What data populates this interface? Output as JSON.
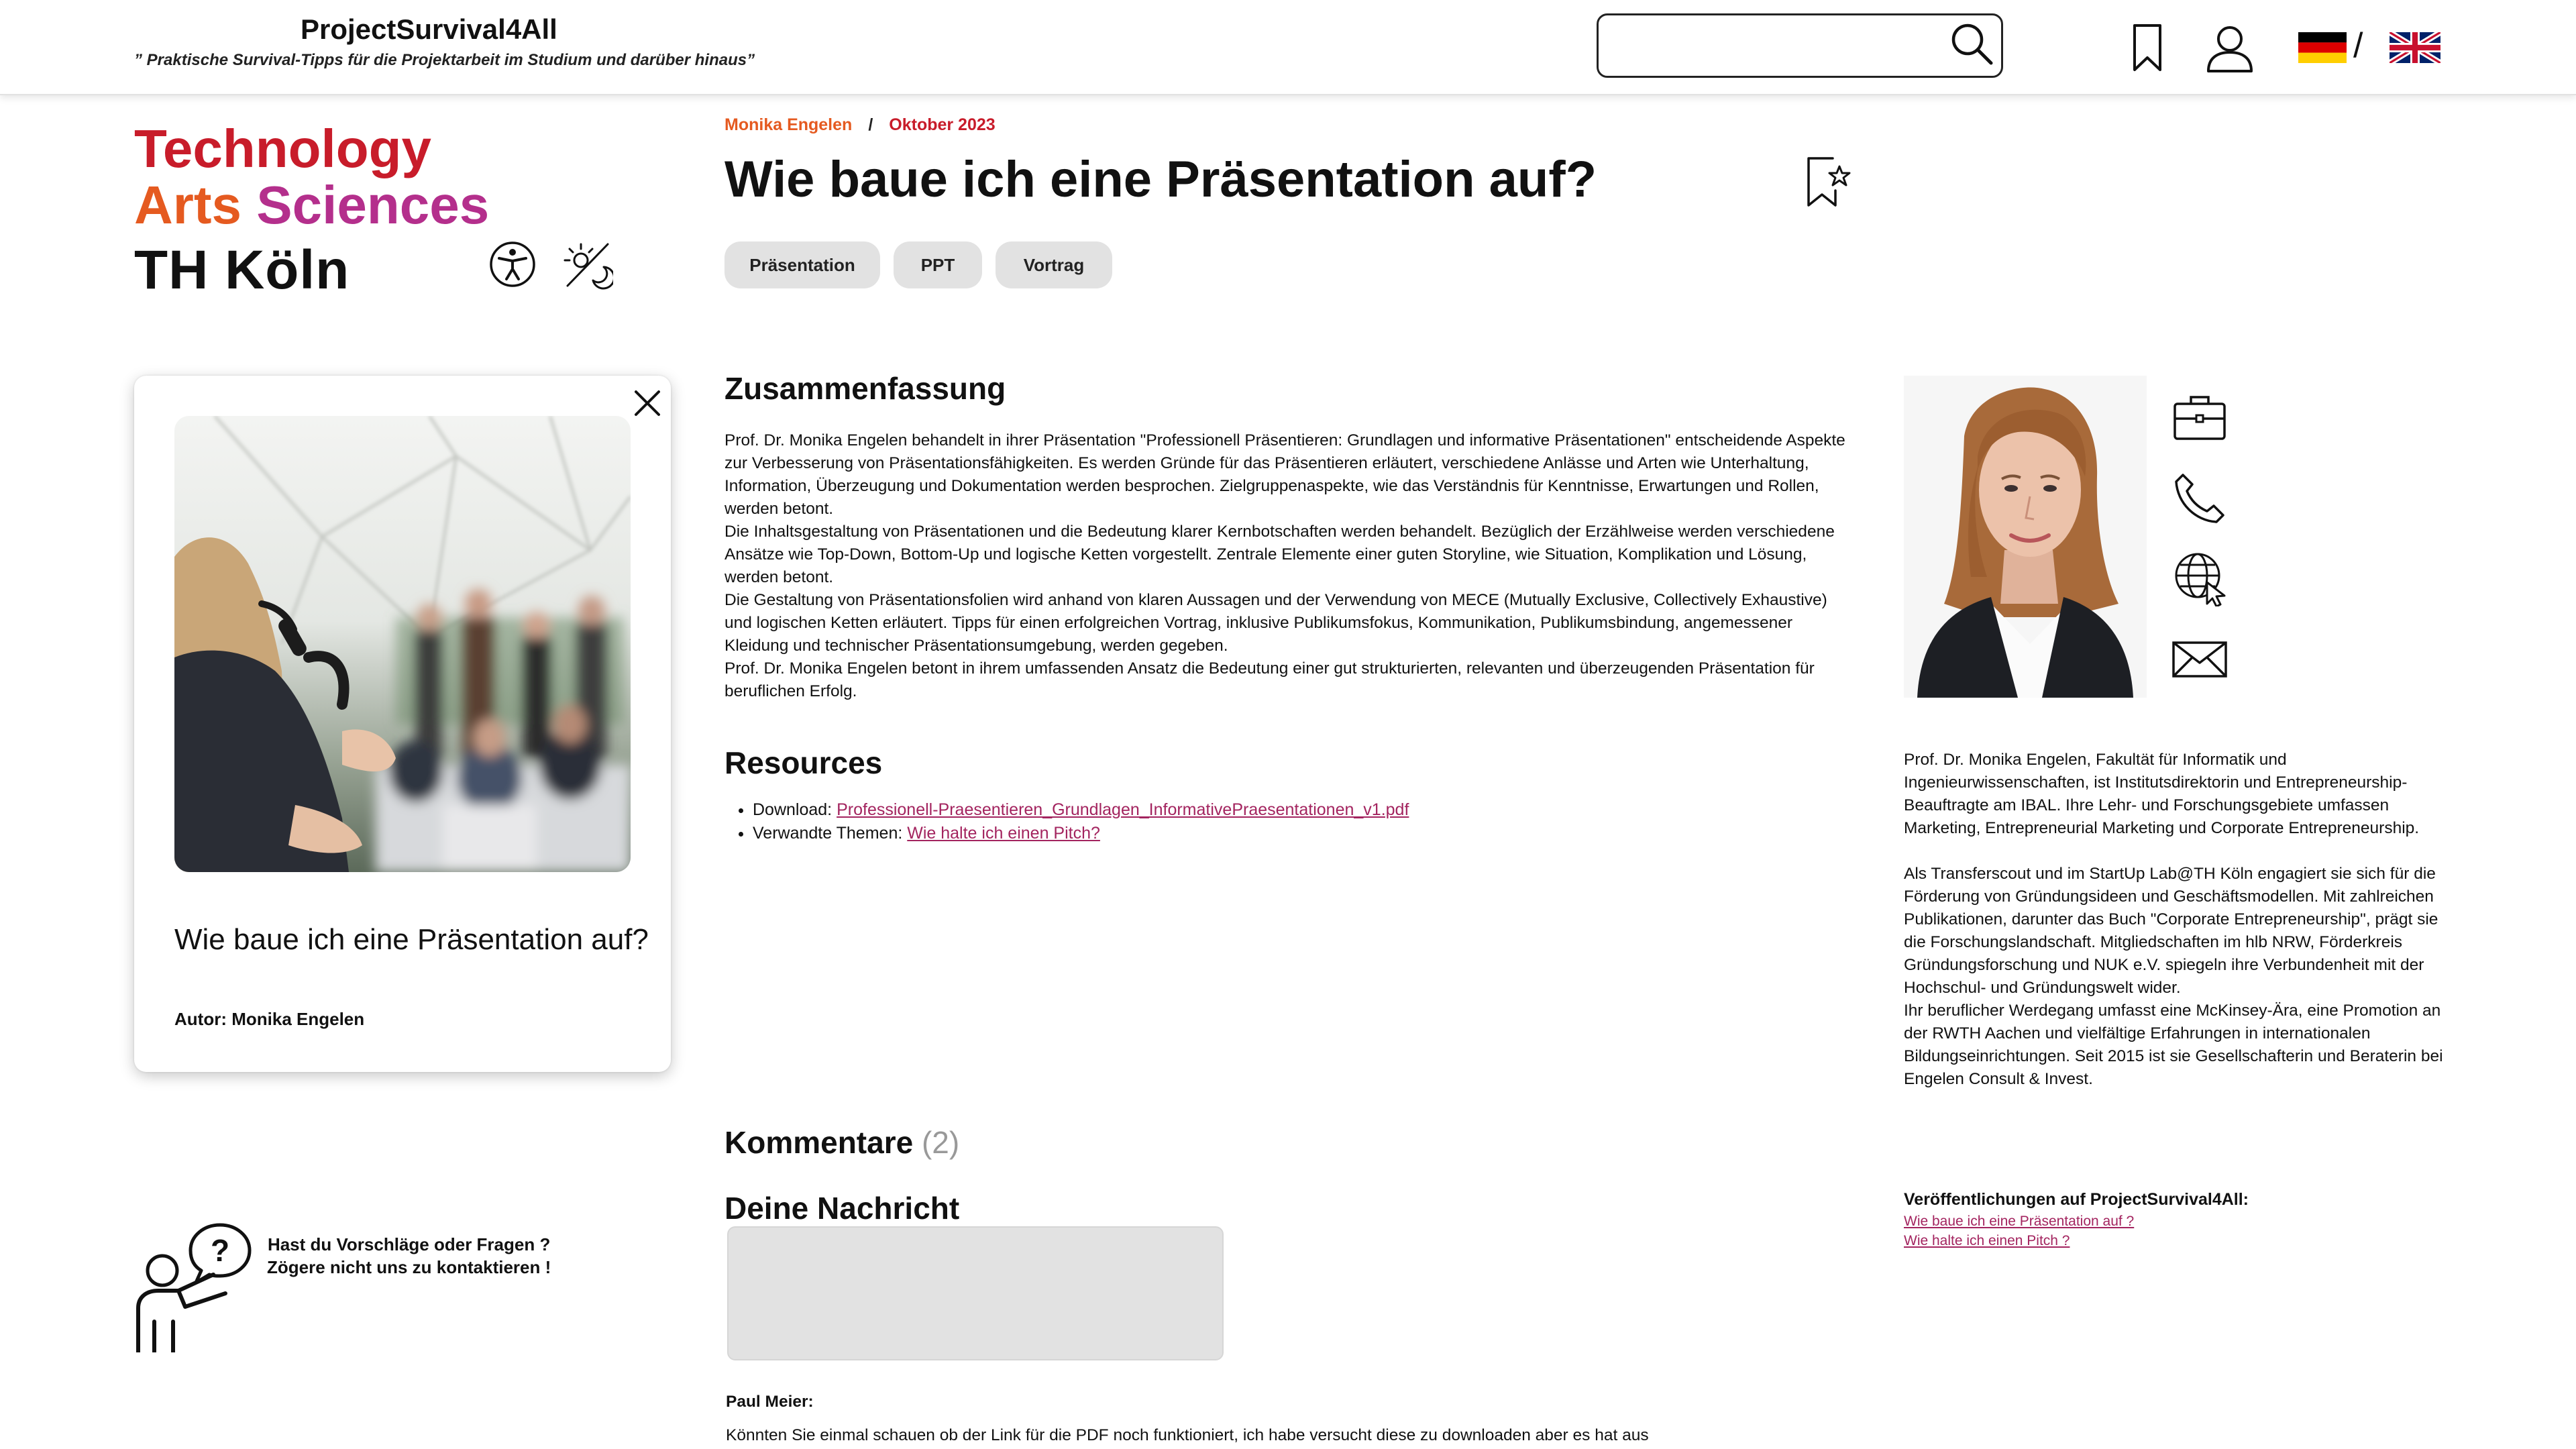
{
  "header": {
    "site_title": "ProjectSurvival4All",
    "tagline": "” Praktische Survival-Tipps für die Projektarbeit im Studium und darüber hinaus”",
    "search": {
      "value": "",
      "placeholder": ""
    },
    "language_separator": "/",
    "languages": [
      "de",
      "en"
    ]
  },
  "logo": {
    "line1": "Technology",
    "line2a": "Arts",
    "line2b": "Sciences",
    "line3": "TH Köln"
  },
  "colors": {
    "accent_red": "#c81c2a",
    "accent_orange": "#e55a20",
    "accent_magenta": "#b42f8c",
    "link": "#a3245f",
    "tag_bg": "#e2e2e2"
  },
  "icons": {
    "header": [
      "search-icon",
      "bookmark-icon",
      "user-icon",
      "flag-germany-icon",
      "flag-uk-icon"
    ],
    "left": [
      "accessibility-icon",
      "theme-toggle-icon",
      "close-icon",
      "contact-question-icon"
    ],
    "main": [
      "favorite-bookmark-star-icon"
    ],
    "contact": [
      "briefcase-icon",
      "phone-icon",
      "globe-icon",
      "mail-icon"
    ]
  },
  "card": {
    "title": "Wie baue ich eine Präsentation auf?",
    "author_label": "Autor:",
    "author_name": "Monika Engelen"
  },
  "contact": {
    "line1": "Hast du Vorschläge oder Fragen ?",
    "line2": "Zögere nicht uns zu kontaktieren !"
  },
  "article": {
    "author": "Monika Engelen",
    "separator": "/",
    "date": "Oktober 2023",
    "title": "Wie baue ich eine Präsentation auf?",
    "tags": [
      "Präsentation",
      "PPT",
      "Vortrag"
    ],
    "summary_heading": "Zusammenfassung",
    "summary": [
      "Prof. Dr. Monika Engelen behandelt in ihrer Präsentation \"Professionell Präsentieren: Grundlagen und informative Präsentationen\" entscheidende Aspekte zur Verbesserung von Präsentationsfähigkeiten. Es werden Gründe für das Präsentieren erläutert, verschiedene Anlässe und Arten wie Unterhaltung, Information, Überzeugung und Dokumentation werden besprochen. Zielgruppenaspekte, wie das Verständnis für Kenntnisse, Erwartungen und Rollen, werden betont.",
      "Die Inhaltsgestaltung von Präsentationen und die Bedeutung klarer Kernbotschaften werden behandelt. Bezüglich der Erzählweise werden verschiedene Ansätze wie Top-Down, Bottom-Up und logische Ketten vorgestellt. Zentrale Elemente einer guten Storyline, wie Situation, Komplikation und Lösung, werden betont.",
      "Die Gestaltung von Präsentationsfolien wird anhand von klaren Aussagen und der Verwendung von MECE (Mutually Exclusive, Collectively Exhaustive) und logischen Ketten erläutert. Tipps für einen erfolgreichen Vortrag, inklusive Publikumsfokus, Kommunikation, Publikumsbindung, angemessener Kleidung und technischer Präsentationsumgebung, werden gegeben.",
      "Prof. Dr. Monika Engelen betont in ihrem umfassenden Ansatz die Bedeutung einer gut strukturierten, relevanten und überzeugenden Präsentation für beruflichen Erfolg."
    ],
    "resources_heading": "Resources",
    "resources": [
      {
        "label": "Download:",
        "link_text": "Professionell-Praesentieren_Grundlagen_InformativePraesentationen_v1.pdf"
      },
      {
        "label": "Verwandte Themen:",
        "link_text": "Wie halte ich einen Pitch?"
      }
    ],
    "comments_heading": "Kommentare",
    "comments_count": "(2)",
    "message_heading": "Deine Nachricht",
    "message": {
      "value": "",
      "placeholder": ""
    },
    "comments": [
      {
        "author": "Paul Meier:",
        "text": "Könnten Sie einmal schauen ob der Link für die PDF noch funktioniert, ich habe versucht diese zu downloaden aber es hat aus"
      }
    ]
  },
  "author_profile": {
    "bio": [
      "Prof. Dr. Monika Engelen, Fakultät für Informatik und Ingenieurwissenschaften, ist Institutsdirektorin und Entrepreneurship-Beauftragte am IBAL. Ihre Lehr- und Forschungsgebiete umfassen Marketing, Entrepreneurial Marketing und Corporate Entrepreneurship.",
      "Als Transferscout und im StartUp Lab@TH Köln engagiert sie sich für die Förderung von Gründungsideen und Geschäftsmodellen. Mit zahlreichen Publikationen, darunter das Buch \"Corporate Entrepreneurship\", prägt sie die Forschungslandschaft. Mitgliedschaften im hlb NRW, Förderkreis Gründungsforschung und NUK e.V. spiegeln ihre Verbundenheit mit der Hochschul- und Gründungswelt wider.",
      "Ihr beruflicher Werdegang umfasst eine McKinsey-Ära, eine Promotion an der RWTH Aachen und vielfältige Erfahrungen in internationalen Bildungseinrichtungen. Seit 2015 ist sie Gesellschafterin und Beraterin bei Engelen Consult & Invest."
    ],
    "publications_heading": "Veröffentlichungen auf ProjectSurvival4All:",
    "publications": [
      "Wie baue ich eine Präsentation auf ?",
      "Wie halte ich einen Pitch ?"
    ]
  }
}
